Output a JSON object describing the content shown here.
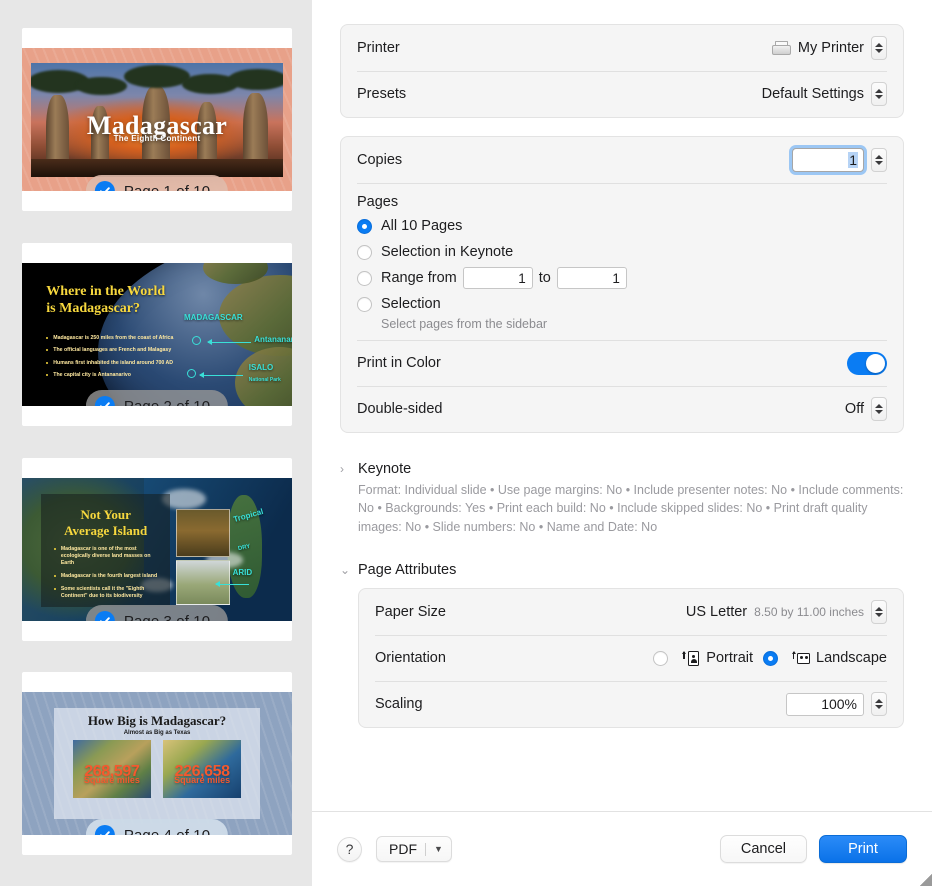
{
  "sidebar": {
    "slides": [
      {
        "badge": "Page 1 of 10",
        "title": "Madagascar",
        "subtitle": "The Eighth Continent"
      },
      {
        "badge": "Page 2 of 10",
        "title_line1": "Where in the World",
        "title_line2": "is Madagascar?",
        "bullets": [
          "Madagascar is 250 miles from the coast of Africa",
          "The official languages are French and Malagasy",
          "Humans first inhabited the island around 700 AD",
          "The capital city is Antananarivo"
        ],
        "map_labels": {
          "country": "MADAGASCAR",
          "city": "Antananarivo",
          "park": "ISALO",
          "park_sub": "National Park"
        }
      },
      {
        "badge": "Page 3 of 10",
        "title_line1": "Not Your",
        "title_line2": "Average Island",
        "bullets": [
          "Madagascar is one of the most ecologically diverse land masses on Earth",
          "Madagascar is the fourth largest island",
          "Some scientists call it the \"Eighth Continent\" due to its biodiversity"
        ],
        "map_labels": {
          "tropical": "Tropical",
          "dry": "DRY",
          "arid": "ARID"
        }
      },
      {
        "badge": "Page 4 of 10",
        "title": "How Big is Madagascar?",
        "subtitle": "Almost as Big as Texas",
        "stats": [
          {
            "number": "268,597",
            "unit": "Square miles"
          },
          {
            "number": "226,658",
            "unit": "Square miles"
          }
        ]
      }
    ]
  },
  "printer_group": {
    "printer_label": "Printer",
    "printer_value": "My Printer",
    "presets_label": "Presets",
    "presets_value": "Default Settings"
  },
  "copies_group": {
    "copies_label": "Copies",
    "copies_value": "1",
    "pages_label": "Pages",
    "options": [
      {
        "label": "All 10 Pages",
        "selected": true
      },
      {
        "label": "Selection in Keynote",
        "selected": false
      },
      {
        "label": "Range from",
        "selected": false
      },
      {
        "label": "Selection",
        "selected": false
      }
    ],
    "range_from_value": "1",
    "range_to_label": "to",
    "range_to_value": "1",
    "selection_hint": "Select pages from the sidebar",
    "print_in_color_label": "Print in Color",
    "print_in_color_state": "on",
    "double_sided_label": "Double-sided",
    "double_sided_value": "Off"
  },
  "keynote_section": {
    "title": "Keynote",
    "summary": "Format: Individual slide • Use page margins: No • Include presenter notes: No • Include comments: No • Backgrounds: Yes • Print each build: No • Include skipped slides: No • Print draft quality images: No • Slide numbers: No • Name and Date: No",
    "expanded": false
  },
  "page_attributes_section": {
    "title": "Page Attributes",
    "expanded": true,
    "paper_size_label": "Paper Size",
    "paper_size_value": "US Letter",
    "paper_size_dimensions": "8.50 by 11.00 inches",
    "orientation_label": "Orientation",
    "orientation_options": [
      {
        "label": "Portrait",
        "selected": false
      },
      {
        "label": "Landscape",
        "selected": true
      }
    ],
    "scaling_label": "Scaling",
    "scaling_value": "100%"
  },
  "footer": {
    "help_label": "?",
    "pdf_label": "PDF",
    "cancel_label": "Cancel",
    "print_label": "Print"
  },
  "colors": {
    "accent": "#0a7cf3",
    "print_button": "#1a7ef5",
    "sidebar_bg": "#e7e7e7",
    "group_bg": "#f5f5f5"
  }
}
